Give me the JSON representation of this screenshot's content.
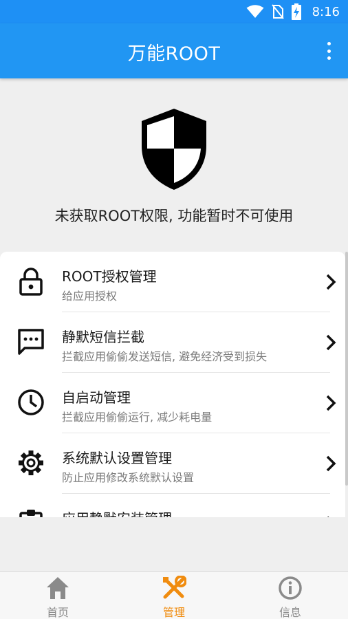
{
  "status_bar": {
    "time": "8:16",
    "icons": [
      "wifi-icon",
      "no-sim-icon",
      "battery-charging-icon"
    ]
  },
  "app_bar": {
    "title": "万能ROOT",
    "menu_icon": "more-vert-icon"
  },
  "root_panel": {
    "icon": "shield-icon",
    "message": "未获取ROOT权限, 功能暂时不可使用"
  },
  "features": [
    {
      "icon": "lock-icon",
      "title": "ROOT授权管理",
      "subtitle": "给应用授权"
    },
    {
      "icon": "sms-icon",
      "title": "静默短信拦截",
      "subtitle": "拦截应用偷偷发送短信, 避免经济受到损失"
    },
    {
      "icon": "clock-icon",
      "title": "自启动管理",
      "subtitle": "拦截应用偷偷运行, 减少耗电量"
    },
    {
      "icon": "gear-icon",
      "title": "系统默认设置管理",
      "subtitle": "防止应用修改系统默认设置"
    },
    {
      "icon": "clipboard-icon",
      "title": "应用静默安装管理",
      "subtitle": ""
    }
  ],
  "bottom_nav": [
    {
      "icon": "home-icon",
      "label": "首页",
      "active": false
    },
    {
      "icon": "tools-icon",
      "label": "管理",
      "active": true
    },
    {
      "icon": "info-icon",
      "label": "信息",
      "active": false
    }
  ],
  "colors": {
    "primary": "#2196f3",
    "status_bar": "#1e90f5",
    "active_tab": "#f08c0f",
    "inactive_tab": "#8a8a8a",
    "background": "#efefef"
  }
}
